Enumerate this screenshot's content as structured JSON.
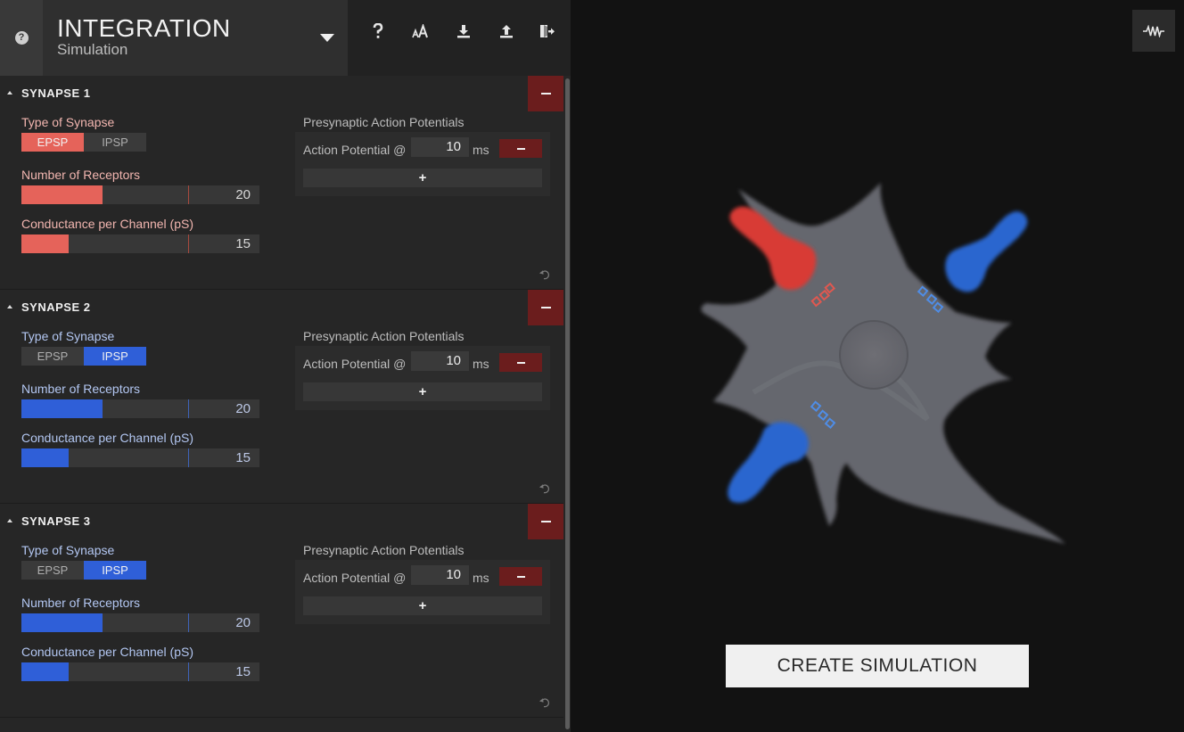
{
  "header": {
    "title": "INTEGRATION",
    "subtitle": "Simulation",
    "help_glyph": "?",
    "help_icon": "help-circle-icon",
    "tools": [
      {
        "name": "help",
        "icon": "question-mark-icon"
      },
      {
        "name": "font-size",
        "icon": "font-size-icon"
      },
      {
        "name": "download",
        "icon": "download-icon"
      },
      {
        "name": "upload",
        "icon": "upload-icon"
      },
      {
        "name": "exit",
        "icon": "exit-icon"
      }
    ]
  },
  "colors": {
    "epsp": "#e5635a",
    "ipsp": "#2f5fd8",
    "epsp_label": "#f2b6b0",
    "ipsp_label": "#b3c7f2",
    "danger": "#6b1d1d",
    "epsp_marker": "#a8493f",
    "ipsp_marker": "#3f63b8"
  },
  "labels": {
    "type_of_synapse": "Type of Synapse",
    "epsp": "EPSP",
    "ipsp": "IPSP",
    "number_of_receptors": "Number of Receptors",
    "conductance": "Conductance per Channel (pS)",
    "presynaptic": "Presynaptic Action Potentials",
    "action_potential": "Action Potential @",
    "ms": "ms",
    "add": "+"
  },
  "synapses": [
    {
      "title": "SYNAPSE 1",
      "type": "EPSP",
      "receptors": "20",
      "receptors_level": 0.34,
      "conductance": "15",
      "conductance_level": 0.2,
      "ap_value": "10"
    },
    {
      "title": "SYNAPSE 2",
      "type": "IPSP",
      "receptors": "20",
      "receptors_level": 0.34,
      "conductance": "15",
      "conductance_level": 0.2,
      "ap_value": "10"
    },
    {
      "title": "SYNAPSE 3",
      "type": "IPSP",
      "receptors": "20",
      "receptors_level": 0.34,
      "conductance": "15",
      "conductance_level": 0.2,
      "ap_value": "10"
    }
  ],
  "canvas": {
    "trace_icon": "waveform-icon",
    "create_button": "CREATE SIMULATION"
  }
}
